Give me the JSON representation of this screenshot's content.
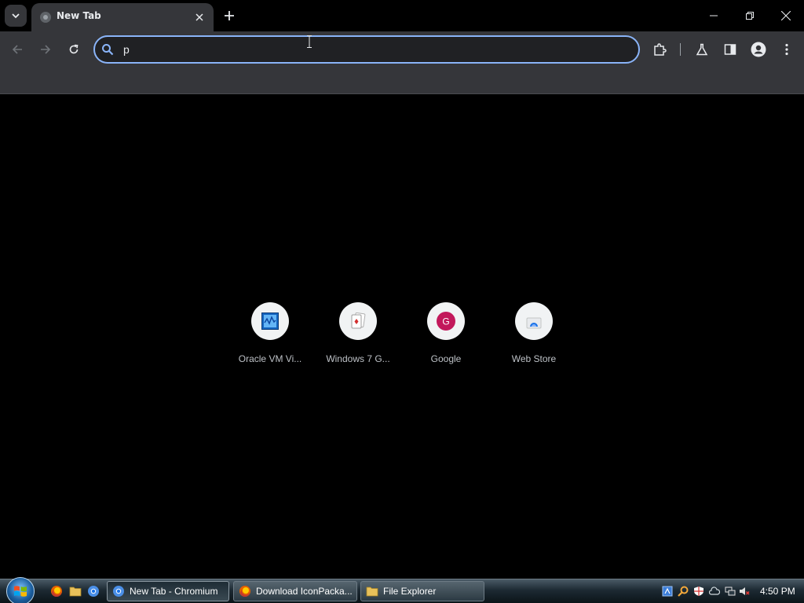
{
  "window": {
    "tab_title": "New Tab",
    "icons": [
      "tab-search-icon",
      "favicon-icon",
      "close-icon",
      "plus-icon",
      "minimize-icon",
      "restore-icon",
      "window-close-icon"
    ]
  },
  "toolbar": {
    "omnibox_value": "p",
    "icons": [
      "back-icon",
      "forward-icon",
      "reload-icon",
      "search-icon",
      "extensions-icon",
      "labs-icon",
      "side-panel-icon",
      "profile-icon",
      "menu-icon"
    ]
  },
  "shortcuts": [
    {
      "label": "Oracle VM Vi...",
      "icon": "virtualbox-icon"
    },
    {
      "label": "Windows 7 G...",
      "icon": "cards-icon"
    },
    {
      "label": "Google",
      "icon": "google-icon",
      "letter": "G"
    },
    {
      "label": "Web Store",
      "icon": "webstore-icon"
    }
  ],
  "taskbar": {
    "quick_launch": [
      "firefox-icon",
      "folder-icon",
      "chromium-icon"
    ],
    "buttons": [
      {
        "label": "New Tab - Chromium",
        "active": true
      },
      {
        "label": "Download IconPacka...",
        "active": false
      },
      {
        "label": "File Explorer",
        "active": false
      }
    ],
    "tray_icons": [
      "network-app-icon",
      "search-tray-icon",
      "security-icon",
      "cloud-icon",
      "network-icon",
      "volume-muted-icon"
    ],
    "clock": "4:50 PM"
  },
  "colors": {
    "accent": "#8ab4f8",
    "toolbar_bg": "#35363a",
    "page_bg": "#000000",
    "google_badge": "#c2185b"
  }
}
